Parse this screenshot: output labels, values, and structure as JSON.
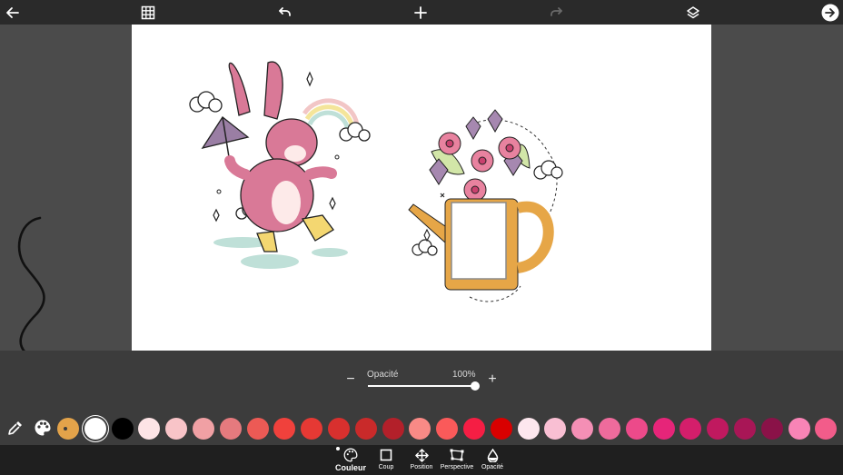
{
  "toolbar": {
    "back_icon": "arrow-left-icon",
    "grid_icon": "grid-icon",
    "undo_icon": "undo-icon",
    "add_icon": "plus-icon",
    "redo_icon": "redo-icon",
    "layers_icon": "layers-icon",
    "next_icon": "arrow-right-circle-icon"
  },
  "canvas": {
    "background": "#ffffff",
    "items": [
      "bunny-illustration",
      "watering-can-illustration"
    ]
  },
  "opacity": {
    "label": "Opacité",
    "value_text": "100%",
    "value": 1.0,
    "minus": "−",
    "plus": "+"
  },
  "palette": {
    "eyedropper_icon": "eyedropper-icon",
    "palette_icon": "palette-icon",
    "selected_index": 0,
    "colors": [
      "#e3a34a",
      "#ffffff",
      "#000000",
      "#fde4e6",
      "#f8c4c8",
      "#f0a0a4",
      "#e57a7e",
      "#ec5a55",
      "#f0413c",
      "#e63934",
      "#d8302e",
      "#c92a2a",
      "#b3202a",
      "#f98a86",
      "#fa5a5a",
      "#f51e44",
      "#d90000",
      "#fde7ee",
      "#f9bfd3",
      "#f48fb5",
      "#ee6b9c",
      "#ec4a8a",
      "#e62579",
      "#d41e6b",
      "#c0195f",
      "#a81656",
      "#8a1248",
      "#f884b6",
      "#f25c8a"
    ]
  },
  "bottom_tabs": [
    {
      "id": "couleur",
      "label": "Couleur",
      "icon": "palette-icon",
      "active": true
    },
    {
      "id": "coup",
      "label": "Coup",
      "icon": "square-outline-icon",
      "active": false
    },
    {
      "id": "position",
      "label": "Position",
      "icon": "move-arrows-icon",
      "active": false
    },
    {
      "id": "perspective",
      "label": "Perspective",
      "icon": "perspective-icon",
      "active": false
    },
    {
      "id": "opacite",
      "label": "Opacité",
      "icon": "drop-icon",
      "active": false
    }
  ],
  "colors": {
    "topbar": "#2a2a2a",
    "panel": "#3c3c3c",
    "bottombar": "#1f1f1f",
    "workspace": "#4b4b4b"
  }
}
